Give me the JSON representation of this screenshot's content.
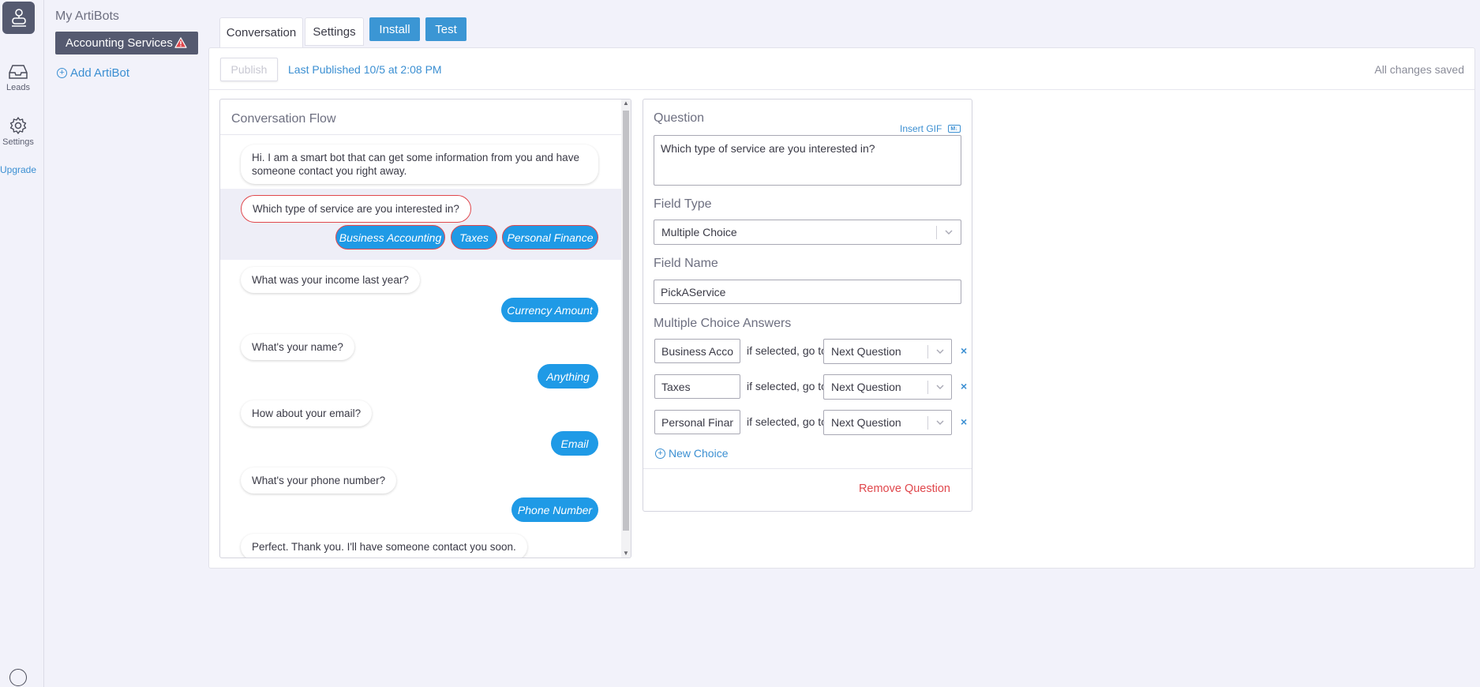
{
  "rail": {
    "leads_label": "Leads",
    "settings_label": "Settings",
    "upgrade_label": "Upgrade"
  },
  "sidebar": {
    "title": "My ArtiBots",
    "bots": [
      {
        "name": "Accounting Services",
        "warning": true
      }
    ],
    "add_label": "Add ArtiBot"
  },
  "tabs": {
    "conversation": "Conversation",
    "settings": "Settings",
    "install": "Install",
    "test": "Test"
  },
  "toolbar": {
    "publish_label": "Publish",
    "last_published": "Last Published 10/5 at 2:08 PM",
    "status": "All changes saved"
  },
  "flow": {
    "title": "Conversation Flow",
    "messages": [
      {
        "text": "Hi. I am a smart bot that can get some information from you and have someone contact you right away."
      },
      {
        "text": "Which type of service are you interested in?",
        "answers": [
          "Business Accounting",
          "Taxes",
          "Personal Finance"
        ]
      },
      {
        "text": "What was your income last year?",
        "answers": [
          "Currency Amount"
        ]
      },
      {
        "text": "What's your name?",
        "answers": [
          "Anything"
        ]
      },
      {
        "text": "How about your email?",
        "answers": [
          "Email"
        ]
      },
      {
        "text": "What's your phone number?",
        "answers": [
          "Phone Number"
        ]
      },
      {
        "text": "Perfect. Thank you. I'll have someone contact you soon."
      }
    ]
  },
  "editor": {
    "question_label": "Question",
    "insert_gif": "Insert GIF",
    "md_badge": "M↓",
    "question_value": "Which type of service are you interested in?",
    "field_type_label": "Field Type",
    "field_type_value": "Multiple Choice",
    "field_name_label": "Field Name",
    "field_name_value": "PickAService",
    "choices_label": "Multiple Choice Answers",
    "goto_text": "if selected, go to",
    "choices": [
      {
        "answer": "Business Accounting",
        "goto": "Next Question"
      },
      {
        "answer": "Taxes",
        "goto": "Next Question"
      },
      {
        "answer": "Personal Finance",
        "goto": "Next Question"
      }
    ],
    "remove_symbol": "×",
    "new_choice": "New Choice",
    "remove_question": "Remove Question"
  },
  "colors": {
    "accent": "#3b96d4",
    "answer_bubble": "#1f9ae6",
    "danger": "#e0474c",
    "sidebar_selected": "#555a70"
  }
}
